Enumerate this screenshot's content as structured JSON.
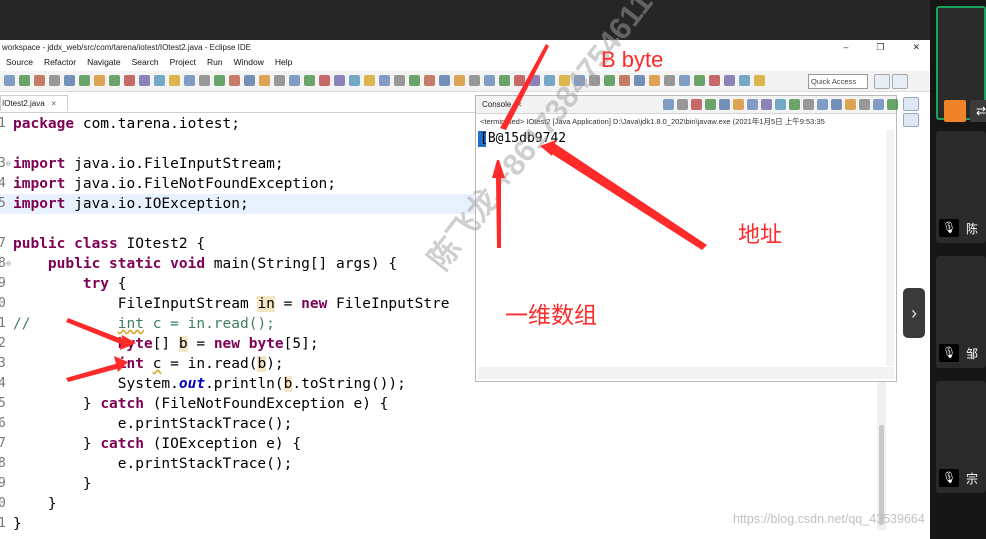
{
  "window": {
    "title": "workspace - jddx_web/src/com/tarena/iotest/IOtest2.java - Eclipse IDE",
    "controls": [
      "–",
      "❐",
      "✕"
    ]
  },
  "menu": [
    "Source",
    "Refactor",
    "Navigate",
    "Search",
    "Project",
    "Run",
    "Window",
    "Help"
  ],
  "toolbar": {
    "quick_access": "Quick Access"
  },
  "editor": {
    "tab": "IOtest2.java",
    "lines": [
      {
        "ln": "1",
        "text": "package com.tarena.iotest;"
      },
      {
        "ln": "",
        "text": ""
      },
      {
        "ln": "3",
        "text": "import java.io.FileInputStream;"
      },
      {
        "ln": "4",
        "text": "import java.io.FileNotFoundException;"
      },
      {
        "ln": "5",
        "text": "import java.io.IOException;"
      },
      {
        "ln": "",
        "text": ""
      },
      {
        "ln": "7",
        "text": "public class IOtest2 {"
      },
      {
        "ln": "8",
        "text": "    public static void main(String[] args) {"
      },
      {
        "ln": "9",
        "text": "        try {"
      },
      {
        "ln": "0",
        "text": "            FileInputStream in = new FileInputStre"
      },
      {
        "ln": "1",
        "text": "//          int c = in.read();"
      },
      {
        "ln": "2",
        "text": "            byte[] b = new byte[5];"
      },
      {
        "ln": "3",
        "text": "            int c = in.read(b);"
      },
      {
        "ln": "4",
        "text": "            System.out.println(b.toString());"
      },
      {
        "ln": "5",
        "text": "        } catch (FileNotFoundException e) {"
      },
      {
        "ln": "6",
        "text": "            e.printStackTrace();"
      },
      {
        "ln": "7",
        "text": "        } catch (IOException e) {"
      },
      {
        "ln": "8",
        "text": "            e.printStackTrace();"
      },
      {
        "ln": "9",
        "text": "        }"
      },
      {
        "ln": "0",
        "text": "    }"
      },
      {
        "ln": "1",
        "text": "}"
      }
    ]
  },
  "console": {
    "tab": "Console",
    "status": "<terminated> IOtest2 [Java Application] D:\\Java\\jdk1.8.0_202\\bin\\javaw.exe (2021年1月5日 上午9:53:35",
    "output": "[B@15db9742"
  },
  "annotations": {
    "b_byte": "B byte",
    "address": "地址",
    "one_dim_array": "一维数组",
    "color": "#ff2b2b"
  },
  "watermark": "陈飞龙 +8617384754611",
  "url_watermark": "https://blog.csdn.net/qq_43539664",
  "meeting": {
    "participants": [
      "陈",
      "邹",
      "宗"
    ]
  }
}
